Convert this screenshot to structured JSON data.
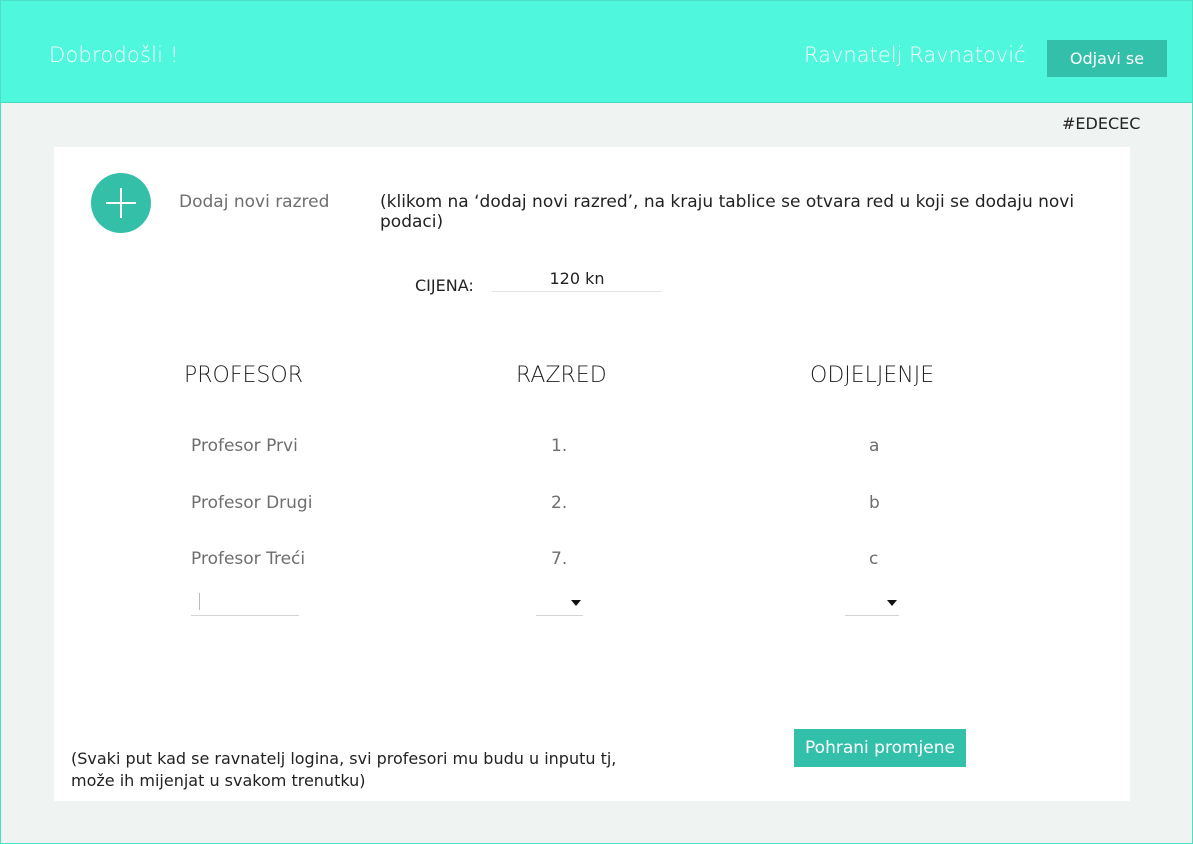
{
  "header": {
    "welcome": "Dobrodošli !",
    "username": "Ravnatelj Ravnatović",
    "logout_label": "Odjavi se"
  },
  "color_note": "#EDECEC",
  "add_class": {
    "label": "Dodaj novi razred",
    "icon": "plus-icon",
    "note": "(klikom na ‘dodaj novi razred’, na kraju tablice se otvara red u koji se dodaju novi podaci)"
  },
  "price": {
    "label": "CIJENA:",
    "value": "120 kn"
  },
  "table": {
    "headers": [
      "PROFESOR",
      "RAZRED",
      "ODJELJENJE"
    ],
    "rows": [
      [
        "Profesor Prvi",
        "1.",
        "a"
      ],
      [
        "Profesor Drugi",
        "2.",
        "b"
      ],
      [
        "Profesor Treći",
        "7.",
        "c"
      ]
    ]
  },
  "save_label": "Pohrani promjene",
  "footer_note": "(Svaki put kad se ravnatelj logina, svi profesori mu budu u inputu tj, može ih mijenjat u svakom trenutku)",
  "colors": {
    "header_bg": "#4ff8dc",
    "accent": "#32c0ab",
    "page_bg": "#eff3f2"
  }
}
